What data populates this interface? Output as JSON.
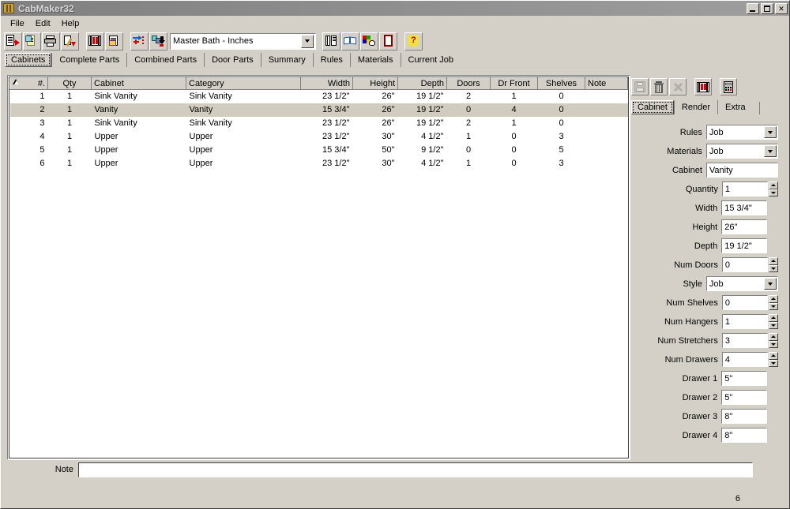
{
  "window": {
    "title": "CabMaker32",
    "icon": "cabinet-icon",
    "buttons": {
      "minimize": "_",
      "maximize": "□",
      "close": "✕"
    }
  },
  "menubar": {
    "items": [
      "File",
      "Edit",
      "Help"
    ]
  },
  "toolbar": {
    "buttons": [
      {
        "name": "export-icon"
      },
      {
        "name": "edit-document-icon"
      },
      {
        "name": "print-icon"
      },
      {
        "name": "tools-icon"
      },
      {
        "name": "cabinet-list-icon"
      },
      {
        "name": "edit-list-icon"
      },
      {
        "name": "add-item-icon"
      },
      {
        "name": "copy-down-icon"
      }
    ],
    "job_combo": {
      "value": "Master Bath - Inches"
    },
    "right_buttons": [
      {
        "name": "books-icon"
      },
      {
        "name": "book-icon"
      },
      {
        "name": "palette-icon"
      },
      {
        "name": "door-icon"
      },
      {
        "name": "help-icon"
      }
    ]
  },
  "tabs": {
    "items": [
      "Cabinets",
      "Complete Parts",
      "Combined Parts",
      "Door Parts",
      "Summary",
      "Rules",
      "Materials",
      "Current Job"
    ],
    "active": "Cabinets"
  },
  "grid": {
    "columns": [
      {
        "label": "#.",
        "align": "right",
        "sorted": true
      },
      {
        "label": "Qty",
        "align": "center"
      },
      {
        "label": "Cabinet",
        "align": "left"
      },
      {
        "label": "Category",
        "align": "left"
      },
      {
        "label": "Width",
        "align": "right"
      },
      {
        "label": "Height",
        "align": "right"
      },
      {
        "label": "Depth",
        "align": "right"
      },
      {
        "label": "Doors",
        "align": "center"
      },
      {
        "label": "Dr Front",
        "align": "center"
      },
      {
        "label": "Shelves",
        "align": "center"
      },
      {
        "label": "Note",
        "align": "left"
      }
    ],
    "rows": [
      {
        "num": "1",
        "qty": "1",
        "cabinet": "Sink Vanity",
        "category": "Sink Vanity",
        "width": "23 1/2\"",
        "height": "26\"",
        "depth": "19 1/2\"",
        "doors": "2",
        "dr_front": "1",
        "shelves": "0",
        "note": "",
        "selected": false
      },
      {
        "num": "2",
        "qty": "1",
        "cabinet": "Vanity",
        "category": "Vanity",
        "width": "15 3/4\"",
        "height": "26\"",
        "depth": "19 1/2\"",
        "doors": "0",
        "dr_front": "4",
        "shelves": "0",
        "note": "",
        "selected": true
      },
      {
        "num": "3",
        "qty": "1",
        "cabinet": "Sink Vanity",
        "category": "Sink Vanity",
        "width": "23 1/2\"",
        "height": "26\"",
        "depth": "19 1/2\"",
        "doors": "2",
        "dr_front": "1",
        "shelves": "0",
        "note": "",
        "selected": false
      },
      {
        "num": "4",
        "qty": "1",
        "cabinet": "Upper",
        "category": "Upper",
        "width": "23 1/2\"",
        "height": "30\"",
        "depth": "4 1/2\"",
        "doors": "1",
        "dr_front": "0",
        "shelves": "3",
        "note": "",
        "selected": false
      },
      {
        "num": "5",
        "qty": "1",
        "cabinet": "Upper",
        "category": "Upper",
        "width": "15 3/4\"",
        "height": "50\"",
        "depth": "9 1/2\"",
        "doors": "0",
        "dr_front": "0",
        "shelves": "5",
        "note": "",
        "selected": false
      },
      {
        "num": "6",
        "qty": "1",
        "cabinet": "Upper",
        "category": "Upper",
        "width": "23 1/2\"",
        "height": "30\"",
        "depth": "4 1/2\"",
        "doors": "1",
        "dr_front": "0",
        "shelves": "3",
        "note": "",
        "selected": false
      }
    ]
  },
  "right_panel": {
    "toolbar": [
      {
        "name": "save-icon",
        "disabled": true
      },
      {
        "name": "delete-icon",
        "disabled": false
      },
      {
        "name": "cancel-icon",
        "disabled": true
      },
      {
        "name": "render-icon",
        "disabled": false
      },
      {
        "name": "calculator-icon",
        "disabled": false
      }
    ],
    "tabs": {
      "items": [
        "Cabinet",
        "Render",
        "Extra"
      ],
      "active": "Cabinet"
    },
    "fields": [
      {
        "label": "Rules",
        "value": "Job",
        "type": "combo"
      },
      {
        "label": "Materials",
        "value": "Job",
        "type": "combo"
      },
      {
        "label": "Cabinet",
        "value": "Vanity",
        "type": "text",
        "wide": true
      },
      {
        "label": "Quantity",
        "value": "1",
        "type": "spin"
      },
      {
        "label": "Width",
        "value": "15 3/4\"",
        "type": "text"
      },
      {
        "label": "Height",
        "value": "26\"",
        "type": "text"
      },
      {
        "label": "Depth",
        "value": "19 1/2\"",
        "type": "text"
      },
      {
        "label": "Num Doors",
        "value": "0",
        "type": "spin"
      },
      {
        "label": "Style",
        "value": "Job",
        "type": "combo"
      },
      {
        "label": "Num Shelves",
        "value": "0",
        "type": "spin"
      },
      {
        "label": "Num Hangers",
        "value": "1",
        "type": "spin"
      },
      {
        "label": "Num Stretchers",
        "value": "3",
        "type": "spin"
      },
      {
        "label": "Num Drawers",
        "value": "4",
        "type": "spin"
      },
      {
        "label": "Drawer 1",
        "value": "5\"",
        "type": "text"
      },
      {
        "label": "Drawer 2",
        "value": "5\"",
        "type": "text"
      },
      {
        "label": "Drawer 3",
        "value": "8\"",
        "type": "text"
      },
      {
        "label": "Drawer 4",
        "value": "8\"",
        "type": "text"
      }
    ]
  },
  "note": {
    "label": "Note",
    "value": "",
    "placeholder": ""
  },
  "status": {
    "count": "6"
  },
  "colors": {
    "face": "#d4d0c8",
    "selection": "#d0ccc0",
    "title_left": "#808080",
    "title_right": "#9e9e9e",
    "accent_red": "#cc0000"
  }
}
